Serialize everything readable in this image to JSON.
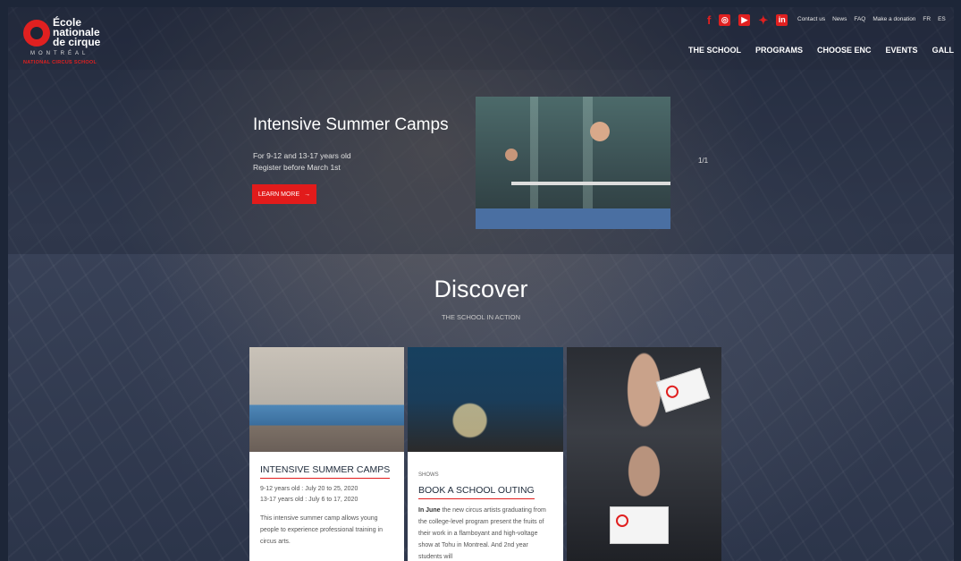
{
  "header": {
    "logo": {
      "line1": "École",
      "line2": "nationale",
      "line3": "de cirque",
      "city": "MONTRÉAL",
      "english": "NATIONAL CIRCUS SCHOOL"
    },
    "social_icons": [
      "facebook-icon",
      "instagram-icon",
      "youtube-icon",
      "twitter-icon",
      "linkedin-icon"
    ],
    "utility_links": [
      "Contact us",
      "News",
      "FAQ",
      "Make a donation",
      "FR",
      "ES"
    ],
    "nav": [
      "THE SCHOOL",
      "PROGRAMS",
      "CHOOSE ENC",
      "EVENTS",
      "GALLERY"
    ]
  },
  "hero": {
    "title": "Intensive Summer Camps",
    "sub1": "For 9-12 and 13-17 years old",
    "sub2": "Register before March 1st",
    "button": "LEARN MORE",
    "counter": "1/1"
  },
  "discover": {
    "title": "Discover",
    "subtitle": "THE SCHOOL IN ACTION"
  },
  "cards": [
    {
      "title": "INTENSIVE SUMMER CAMPS",
      "line1": "9-12 years old : July 20 to 25, 2020",
      "line2": "13-17 years old : July 6 to 17, 2020",
      "para": "This intensive summer camp allows young people to experience professional training in circus arts."
    },
    {
      "category": "SHOWS",
      "title": "BOOK A SCHOOL OUTING",
      "para_bold": "In June",
      "para": " the new circus artists graduating from the college-level program present the fruits of their work in a flamboyant and high-voltage show at Tohu in Montreal. And 2nd year students will"
    }
  ],
  "colors": {
    "accent": "#e21b1b",
    "background": "#2c354a"
  }
}
